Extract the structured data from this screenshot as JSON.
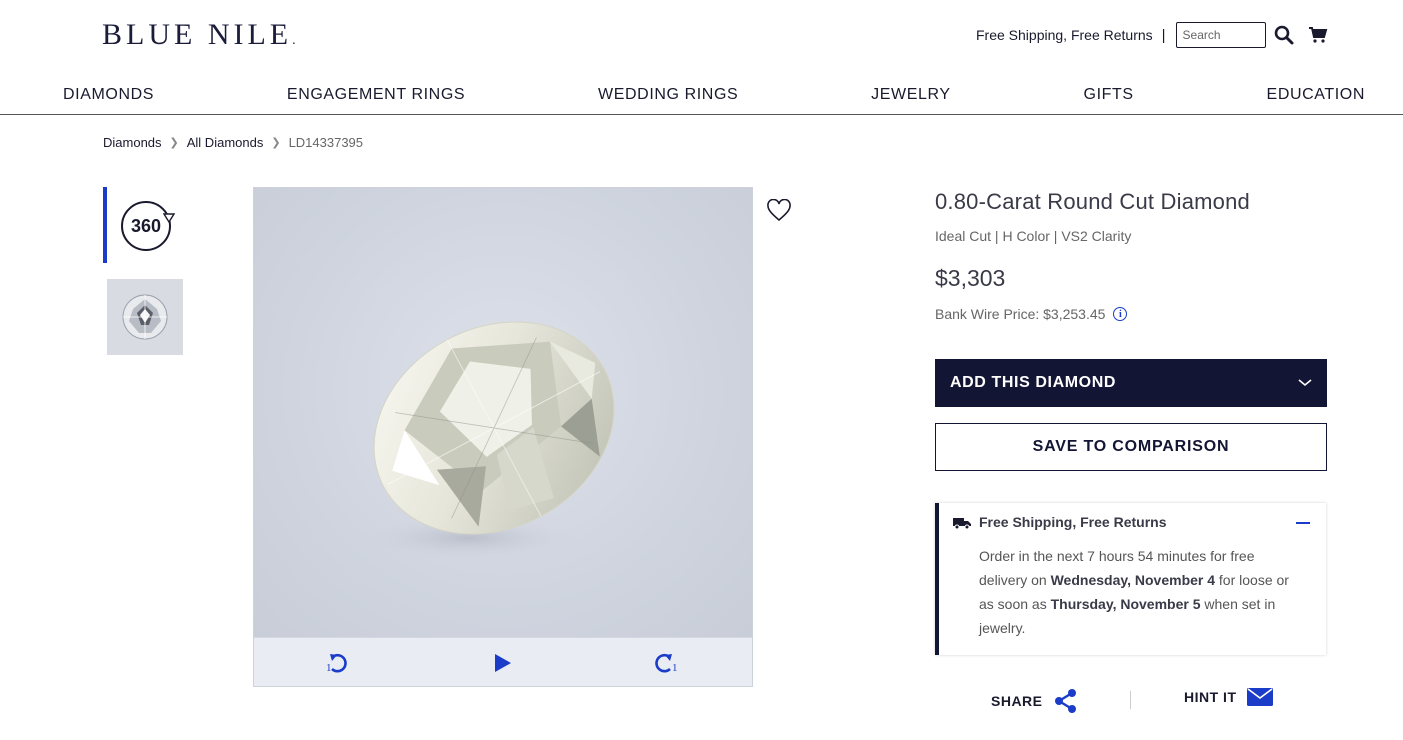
{
  "header": {
    "logo": "BLUE NILE",
    "logo_mark": ".",
    "shipping_text": "Free Shipping, Free Returns",
    "separator": "|",
    "search_placeholder": "Search"
  },
  "nav": [
    "DIAMONDS",
    "ENGAGEMENT RINGS",
    "WEDDING RINGS",
    "JEWELRY",
    "GIFTS",
    "EDUCATION"
  ],
  "breadcrumb": [
    "Diamonds",
    "All Diamonds",
    "LD14337395"
  ],
  "thumbnails": {
    "label_360": "360"
  },
  "viewer": {
    "rotate_left_label": "1",
    "rotate_right_label": "1"
  },
  "product": {
    "title": "0.80-Carat Round Cut Diamond",
    "subtitle": "Ideal Cut | H Color | VS2 Clarity",
    "price": "$3,303",
    "bank_wire": "Bank Wire Price: $3,253.45",
    "info_glyph": "i"
  },
  "actions": {
    "add_label": "ADD THIS DIAMOND",
    "save_label": "SAVE TO COMPARISON"
  },
  "shipping": {
    "heading": "Free Shipping, Free Returns",
    "line1": "Order in the next 7 hours 54 minutes for free delivery on ",
    "date1": "Wednesday, November 4",
    "line2": " for loose or as soon as ",
    "date2": "Thursday, November 5",
    "line3": " when set in jewelry."
  },
  "footer_actions": {
    "share_label": "SHARE",
    "hint_label": "HINT IT"
  },
  "colors": {
    "accent": "#1a3cc8",
    "navy": "#131534"
  }
}
